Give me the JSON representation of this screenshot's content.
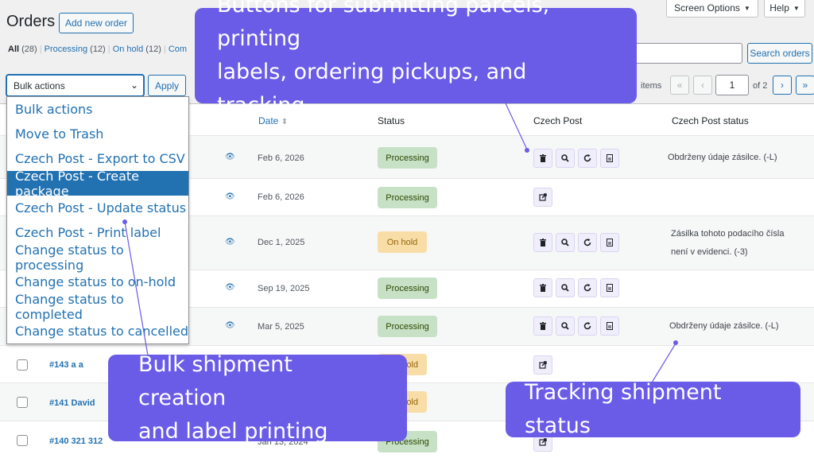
{
  "header": {
    "title": "Orders",
    "add_new": "Add new order",
    "screen_options": "Screen Options",
    "help": "Help"
  },
  "filters": {
    "all": "All",
    "all_count": "(28)",
    "processing": "Processing",
    "processing_count": "(12)",
    "onhold": "On hold",
    "onhold_count": "(12)",
    "completed_partial": "Com"
  },
  "search": {
    "button": "Search orders"
  },
  "bulk": {
    "selected": "Bulk actions",
    "apply": "Apply"
  },
  "pagination": {
    "items_text": "items",
    "first": "«",
    "prev": "‹",
    "page": "1",
    "of": "of 2",
    "next": "›",
    "last": "»"
  },
  "columns": {
    "date": "Date",
    "status": "Status",
    "czech_post": "Czech Post",
    "czech_post_status": "Czech Post status"
  },
  "rows": [
    {
      "date": "Feb 6, 2026",
      "status": "Processing",
      "status_type": "processing",
      "actions": "full",
      "cp_status": "Obdrženy údaje zásilce. (-L)"
    },
    {
      "date": "Feb 6, 2026",
      "status": "Processing",
      "status_type": "processing",
      "actions": "link",
      "cp_status": ""
    },
    {
      "date": "Dec 1, 2025",
      "status": "On hold",
      "status_type": "onhold",
      "actions": "full",
      "cp_status_line1": "Zásilka tohoto podacího čísla",
      "cp_status_line2": "není v evidenci. (-3)"
    },
    {
      "date": "Sep 19, 2025",
      "status": "Processing",
      "status_type": "processing",
      "actions": "full",
      "cp_status": ""
    },
    {
      "date": "Mar 5, 2025",
      "status": "Processing",
      "status_type": "processing",
      "actions": "full",
      "cp_status": "Obdrženy údaje zásilce. (-L)"
    },
    {
      "order": "#143 a a",
      "status_fragment": "old",
      "actions": "link"
    },
    {
      "order": "#141 David",
      "status_fragment": "old"
    },
    {
      "order": "#140 321 312",
      "date_fragment": "Jan 13, 2024",
      "status_fragment": "Processing",
      "actions": "link"
    }
  ],
  "dropdown": [
    "Bulk actions",
    "Move to Trash",
    "Czech Post - Export to CSV",
    "Czech Post - Create package",
    "Czech Post - Update status",
    "Czech Post - Print label",
    "Change status to processing",
    "Change status to on-hold",
    "Change status to completed",
    "Change status to cancelled"
  ],
  "callouts": {
    "top_line1": "Buttons for submitting parcels, printing",
    "top_line2": "labels, ordering pickups, and tracking",
    "bulk_line1": "Bulk shipment creation",
    "bulk_line2": "and label printing",
    "tracking": "Tracking shipment status"
  },
  "icons": [
    "trash-icon",
    "search-icon",
    "refresh-icon",
    "label-icon",
    "external-link-icon",
    "eye-icon",
    "sort-icon",
    "chevron-down-icon"
  ],
  "colors": {
    "accent": "#2271b1",
    "callout": "#6b5ce7",
    "processing_bg": "#c6e1c6",
    "onhold_bg": "#f8dda7"
  }
}
